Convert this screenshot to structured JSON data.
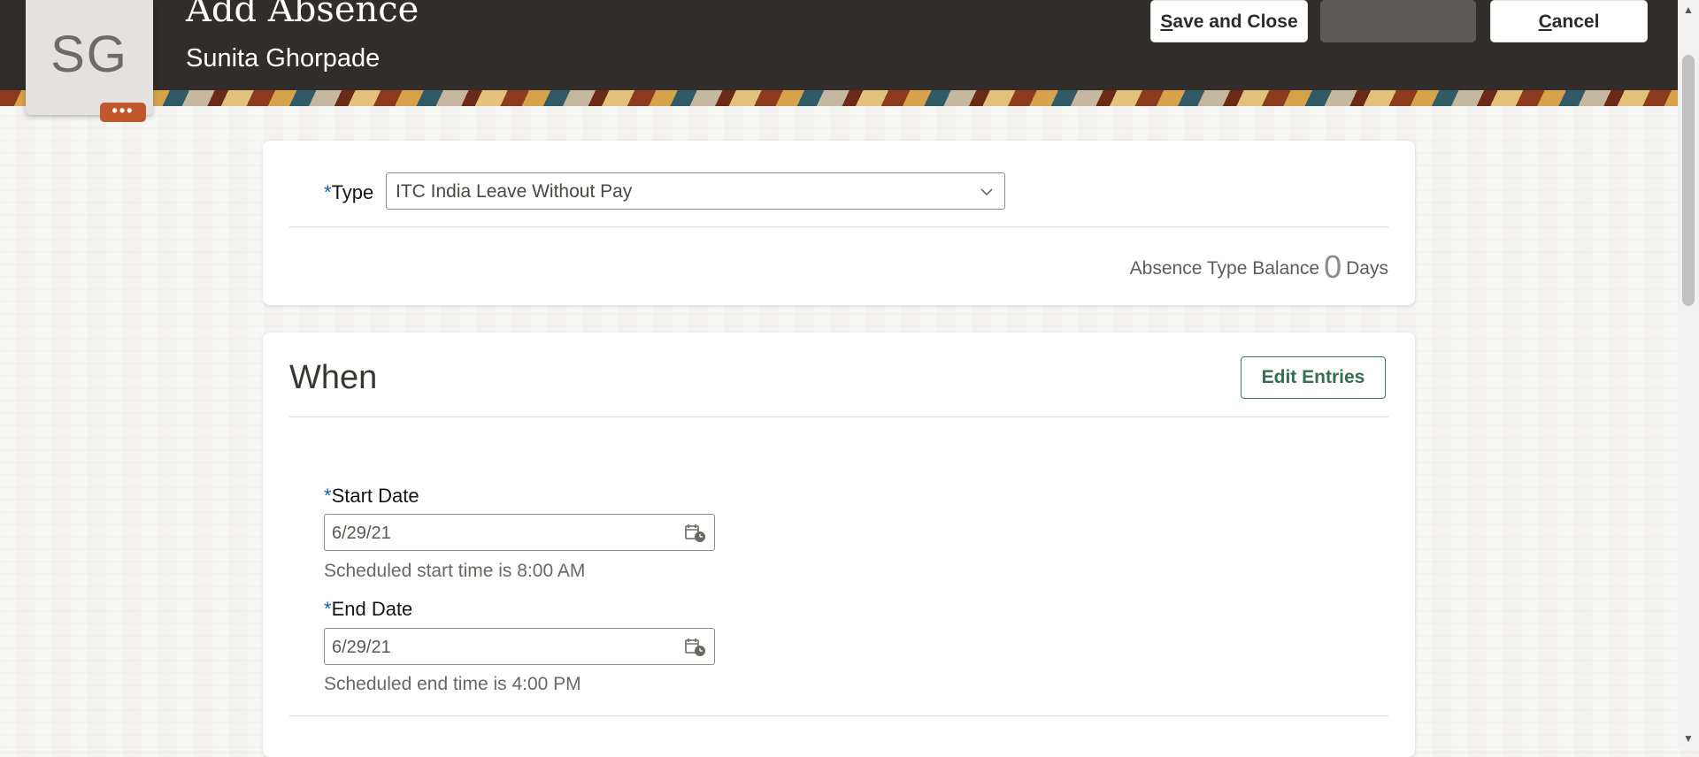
{
  "header": {
    "title": "Add Absence",
    "subtitle": "Sunita Ghorpade",
    "avatar_initials": "SG",
    "more_label": "•••",
    "save_close_prefix": "S",
    "save_close_rest": "ave and Close",
    "cancel_prefix": "C",
    "cancel_rest": "ancel"
  },
  "type_card": {
    "required_mark": "*",
    "type_label": "Type",
    "type_value": "ITC India Leave Without Pay",
    "balance_label": "Absence Type Balance",
    "balance_value": "0",
    "balance_unit": "Days"
  },
  "when_card": {
    "title": "When",
    "edit_entries_label": "Edit Entries",
    "start_date_label": "Start Date",
    "start_date_value": "6/29/21",
    "start_hint": "Scheduled start time is 8:00 AM",
    "end_date_label": "End Date",
    "end_date_value": "6/29/21",
    "end_hint": "Scheduled end time is 4:00 PM"
  },
  "colors": {
    "header_bg": "#312d2a",
    "accent_green": "#356e52",
    "required_blue": "#1e5fa8",
    "badge_orange": "#c0582c"
  },
  "icons": [
    "chevron-down-icon",
    "calendar-icon",
    "more-icon"
  ]
}
